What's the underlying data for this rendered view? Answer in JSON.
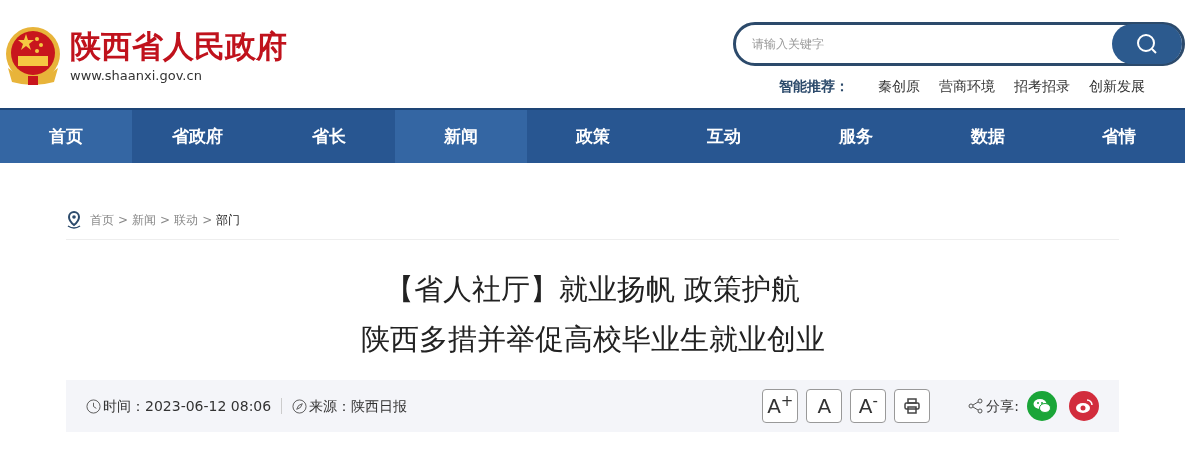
{
  "header": {
    "site_name": "陕西省人民政府",
    "site_url": "www.shaanxi.gov.cn",
    "search": {
      "placeholder": "请输入关键字"
    },
    "recommend": {
      "label": "智能推荐：",
      "links": [
        "秦创原",
        "营商环境",
        "招考招录",
        "创新发展"
      ]
    }
  },
  "nav": [
    {
      "label": "首页",
      "selected": true
    },
    {
      "label": "省政府",
      "selected": false
    },
    {
      "label": "省长",
      "selected": false
    },
    {
      "label": "新闻",
      "selected": true
    },
    {
      "label": "政策",
      "selected": false
    },
    {
      "label": "互动",
      "selected": false
    },
    {
      "label": "服务",
      "selected": false
    },
    {
      "label": "数据",
      "selected": false
    },
    {
      "label": "省情",
      "selected": false
    }
  ],
  "breadcrumb": [
    "首页",
    ">",
    "新闻",
    ">",
    "联动",
    ">",
    "部门"
  ],
  "article": {
    "title_lines": [
      "【省人社厅】就业扬帆 政策护航",
      "陕西多措并举促高校毕业生就业创业"
    ],
    "time": "时间：2023-06-12 08:06",
    "source": "来源：陕西日报",
    "font_buttons": [
      {
        "kind": "larger",
        "label": "A$^{+}$"
      },
      {
        "kind": "normal",
        "label": "A"
      },
      {
        "kind": "smaller",
        "label": "A$^{-}$"
      },
      {
        "kind": "print"
      }
    ],
    "share_label": "分享:",
    "share": [
      {
        "kind": "wechat"
      },
      {
        "kind": "weibo"
      }
    ]
  }
}
